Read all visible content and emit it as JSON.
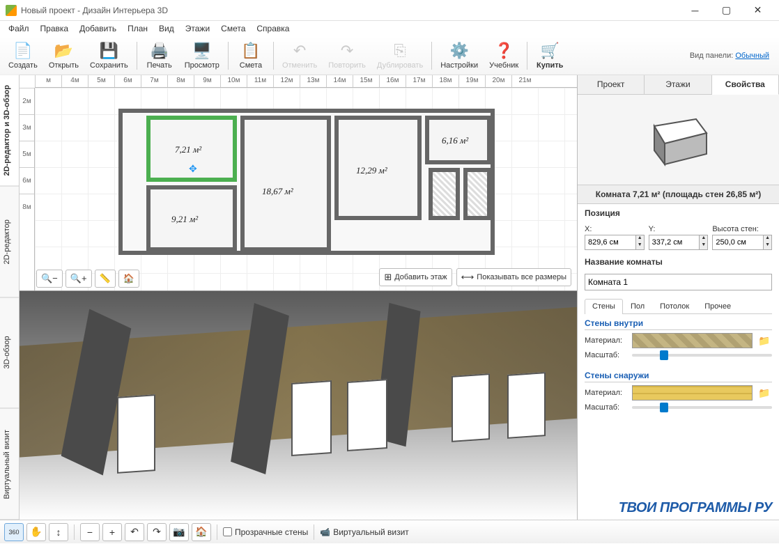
{
  "window": {
    "title": "Новый проект - Дизайн Интерьера 3D"
  },
  "menu": [
    "Файл",
    "Правка",
    "Добавить",
    "План",
    "Вид",
    "Этажи",
    "Смета",
    "Справка"
  ],
  "toolbar": {
    "create": "Создать",
    "open": "Открыть",
    "save": "Сохранить",
    "print": "Печать",
    "preview": "Просмотр",
    "estimate": "Смета",
    "undo": "Отменить",
    "redo": "Повторить",
    "duplicate": "Дублировать",
    "settings": "Настройки",
    "help": "Учебник",
    "buy": "Купить",
    "panelview_label": "Вид панели:",
    "panelview_value": "Обычный"
  },
  "sidetabs": {
    "t1": "2D-редактор и 3D-обзор",
    "t2": "2D-редактор",
    "t3": "3D-обзор",
    "t4": "Виртуальный визит"
  },
  "ruler_h": [
    "м",
    "4м",
    "5м",
    "6м",
    "7м",
    "8м",
    "9м",
    "10м",
    "11м",
    "12м",
    "13м",
    "14м",
    "15м",
    "16м",
    "17м",
    "18м",
    "19м",
    "20м",
    "21м"
  ],
  "ruler_v": [
    "2м",
    "3м",
    "5м",
    "6м",
    "8м"
  ],
  "rooms": {
    "r1": "7,21 м²",
    "r2": "6,16 м²",
    "r3": "18,67 м²",
    "r4": "12,29 м²",
    "r5": "9,21 м²"
  },
  "plan_actions": {
    "add_floor": "Добавить этаж",
    "show_dims": "Показывать все размеры"
  },
  "props": {
    "tabs": {
      "project": "Проект",
      "floors": "Этажи",
      "properties": "Свойства"
    },
    "room_title": "Комната 7,21 м²  (площадь стен 26,85 м²)",
    "position_label": "Позиция",
    "x_label": "X:",
    "y_label": "Y:",
    "h_label": "Высота стен:",
    "x_val": "829,6 см",
    "y_val": "337,2 см",
    "h_val": "250,0 см",
    "name_label": "Название комнаты",
    "name_val": "Комната 1",
    "subtabs": {
      "walls": "Стены",
      "floor": "Пол",
      "ceiling": "Потолок",
      "other": "Прочее"
    },
    "walls_in": "Стены внутри",
    "walls_out": "Стены снаружи",
    "material": "Материал:",
    "scale": "Масштаб:"
  },
  "status": {
    "transparent": "Прозрачные стены",
    "virtual": "Виртуальный визит"
  },
  "watermark": "ТВОИ ПРОГРАММЫ РУ"
}
